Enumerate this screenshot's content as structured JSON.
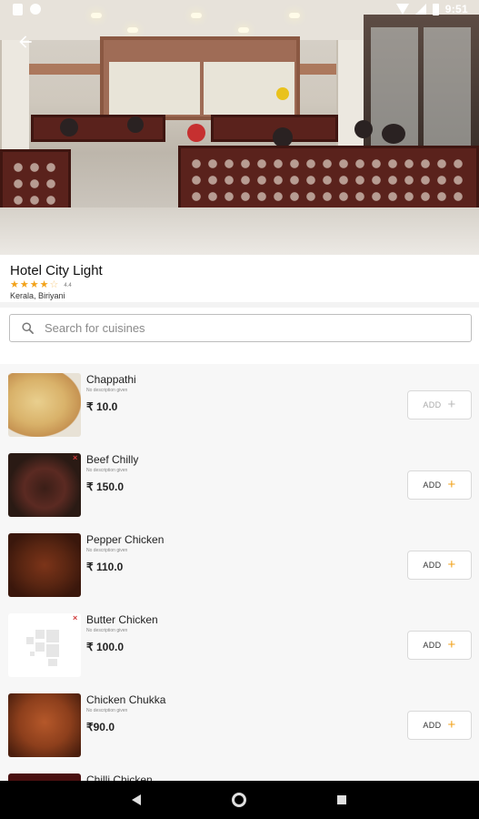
{
  "status_bar": {
    "time": "9:51"
  },
  "restaurant": {
    "name": "Hotel City Light",
    "rating": "4.4",
    "stars": 4,
    "stars_total": 5,
    "cuisines": "Kerala, Biriyani"
  },
  "search": {
    "placeholder": "Search for cuisines"
  },
  "menu": {
    "items": [
      {
        "name": "Chappathi",
        "description": "No description given",
        "price": "₹ 10.0",
        "add_label": "ADD",
        "add_enabled": false,
        "nonveg": false
      },
      {
        "name": "Beef Chilly",
        "description": "No description given",
        "price": "₹ 150.0",
        "add_label": "ADD",
        "add_enabled": true,
        "nonveg": true
      },
      {
        "name": "Pepper Chicken",
        "description": "No description given",
        "price": "₹ 110.0",
        "add_label": "ADD",
        "add_enabled": true,
        "nonveg": true
      },
      {
        "name": "Butter Chicken",
        "description": "No description given",
        "price": "₹ 100.0",
        "add_label": "ADD",
        "add_enabled": true,
        "nonveg": true
      },
      {
        "name": "Chicken Chukka",
        "description": "No description given",
        "price": "₹90.0",
        "add_label": "ADD",
        "add_enabled": true,
        "nonveg": true
      },
      {
        "name": "Chilli Chicken"
      }
    ]
  },
  "colors": {
    "accent": "#f2a21a",
    "nonveg_marker": "#d03b3b"
  },
  "icons": {
    "back": "arrow-left-icon",
    "search": "search-icon",
    "star": "star-icon",
    "plus": "plus-icon"
  }
}
